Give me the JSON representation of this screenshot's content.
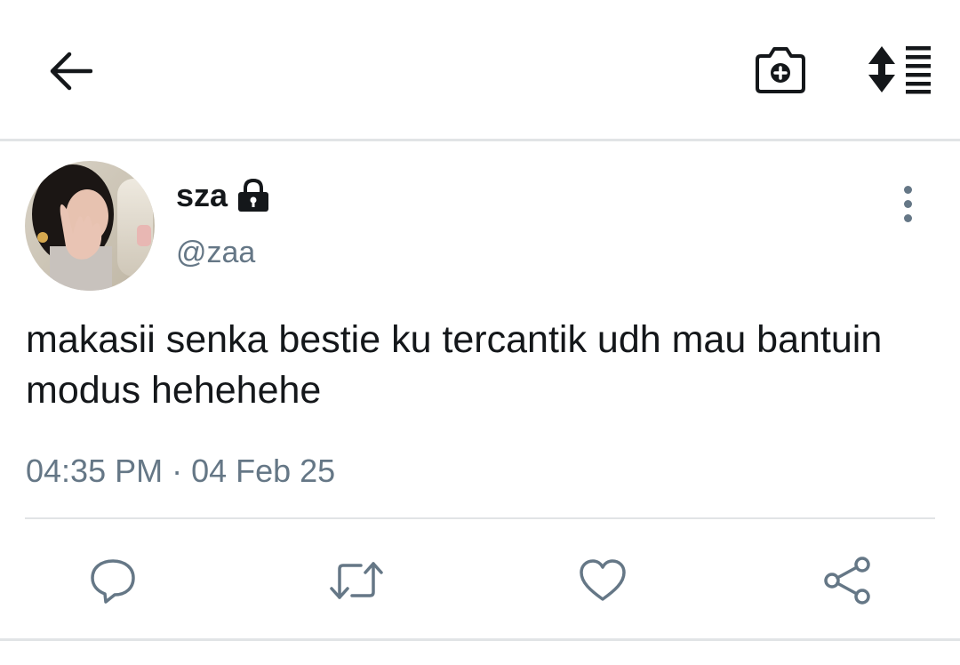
{
  "header": {
    "back_icon": "arrow-left-icon",
    "camera_icon": "camera-plus-icon",
    "sort_icon": "sort-list-icon"
  },
  "tweet": {
    "display_name": "sza",
    "protected_icon": "lock-icon",
    "handle": "@zaa",
    "text": "makasii senka bestie ku tercantik udh mau bantuin modus hehehehe",
    "timestamp": "04:35 PM · 04 Feb 25",
    "more_icon": "more-vertical-icon"
  },
  "actions": [
    {
      "name": "reply",
      "icon": "comment-bubble-icon"
    },
    {
      "name": "retweet",
      "icon": "retweet-icon"
    },
    {
      "name": "like",
      "icon": "heart-icon"
    },
    {
      "name": "share",
      "icon": "share-icon"
    }
  ],
  "colors": {
    "text_primary": "#14171a",
    "text_secondary": "#657786",
    "divider": "#e1e4e6",
    "background": "#ffffff"
  }
}
